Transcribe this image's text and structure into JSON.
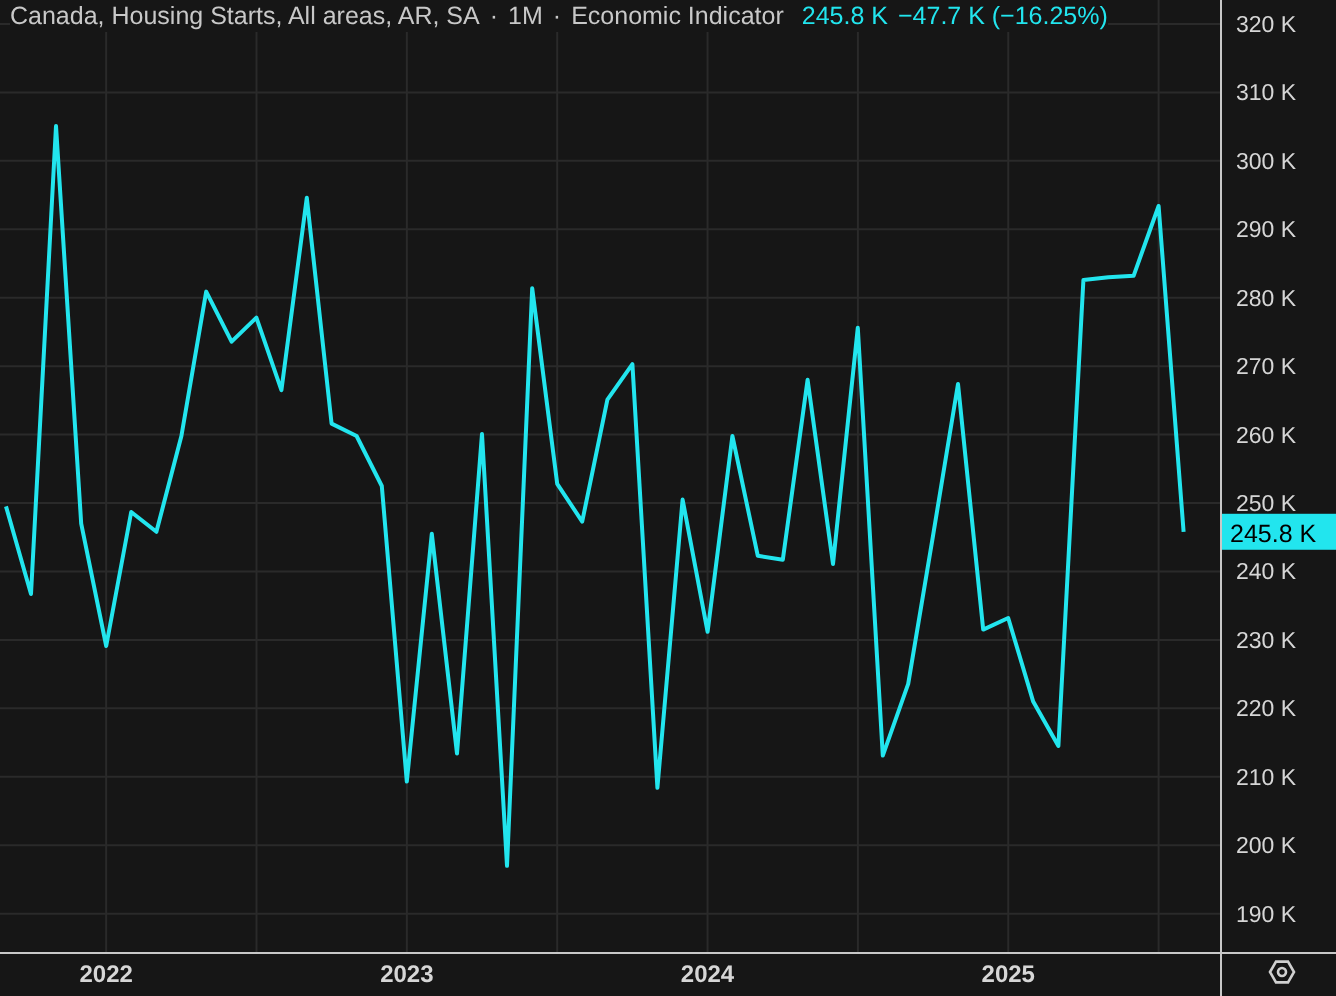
{
  "header": {
    "title": "Canada, Housing Starts, All areas, AR, SA",
    "interval": "1M",
    "separator": "·",
    "type": "Economic Indicator",
    "last_value": "245.8 K",
    "change": "−47.7 K (−16.25%)"
  },
  "chart": {
    "price_label": "245.8 K",
    "chart_data": {
      "type": "line",
      "grid": true,
      "x": [
        2021.667,
        2021.75,
        2021.833,
        2021.917,
        2022.0,
        2022.083,
        2022.167,
        2022.25,
        2022.333,
        2022.417,
        2022.5,
        2022.583,
        2022.667,
        2022.75,
        2022.833,
        2022.917,
        2023.0,
        2023.083,
        2023.167,
        2023.25,
        2023.333,
        2023.417,
        2023.5,
        2023.583,
        2023.667,
        2023.75,
        2023.833,
        2023.917,
        2024.0,
        2024.083,
        2024.167,
        2024.25,
        2024.333,
        2024.417,
        2024.5,
        2024.583,
        2024.667,
        2024.75,
        2024.833,
        2024.917,
        2025.0,
        2025.083,
        2025.167,
        2025.25,
        2025.333,
        2025.417,
        2025.5,
        2025.583
      ],
      "series": [
        {
          "color": "#22e5ee",
          "values": [
            249.5,
            236.7,
            305.1,
            247,
            229.1,
            248.7,
            245.8,
            259.8,
            280.9,
            273.6,
            277.1,
            266.5,
            294.6,
            261.6,
            259.8,
            252.5,
            209.3,
            245.5,
            213.4,
            260.1,
            197.0,
            281.4,
            252.8,
            247.3,
            265.1,
            270.3,
            208.4,
            250.5,
            231.2,
            259.8,
            242.3,
            241.7,
            268.0,
            241.1,
            275.6,
            213.1,
            223.6,
            245.2,
            267.4,
            231.5,
            233.2,
            221.0,
            214.5,
            282.6,
            283.0,
            283.2,
            293.4,
            245.8
          ]
        }
      ],
      "xlim": [
        2021.647,
        2026.09
      ],
      "ylim": [
        184.4,
        323.5
      ],
      "yticks": [
        {
          "value": 190,
          "label": "190 K"
        },
        {
          "value": 200,
          "label": "200 K"
        },
        {
          "value": 210,
          "label": "210 K"
        },
        {
          "value": 220,
          "label": "220 K"
        },
        {
          "value": 230,
          "label": "230 K"
        },
        {
          "value": 240,
          "label": "240 K"
        },
        {
          "value": 250,
          "label": "250 K"
        },
        {
          "value": 260,
          "label": "260 K"
        },
        {
          "value": 270,
          "label": "270 K"
        },
        {
          "value": 280,
          "label": "280 K"
        },
        {
          "value": 290,
          "label": "290 K"
        },
        {
          "value": 300,
          "label": "300 K"
        },
        {
          "value": 310,
          "label": "310 K"
        },
        {
          "value": 320,
          "label": "320 K"
        }
      ],
      "xticks": [
        {
          "value": 2022,
          "label": "2022"
        },
        {
          "value": 2023,
          "label": "2023"
        },
        {
          "value": 2024,
          "label": "2024"
        },
        {
          "value": 2025,
          "label": "2025"
        }
      ]
    }
  }
}
